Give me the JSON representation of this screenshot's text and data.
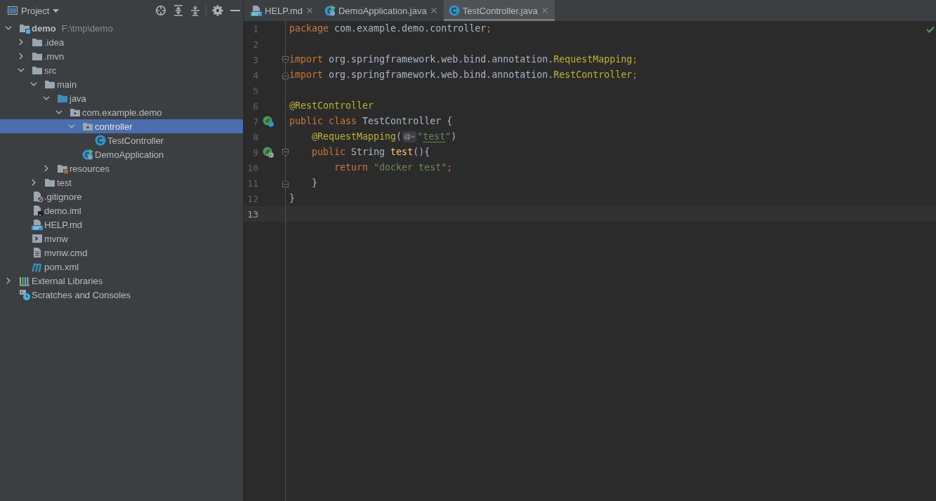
{
  "project": {
    "title": "Project",
    "tree": [
      {
        "label": "demo",
        "path": "F:\\tmp\\demo",
        "kind": "module",
        "expanded": true,
        "selected": false,
        "children": [
          {
            "label": ".idea",
            "kind": "folder",
            "expanded": false,
            "selected": false
          },
          {
            "label": ".mvn",
            "kind": "folder",
            "expanded": false,
            "selected": false
          },
          {
            "label": "src",
            "kind": "folder",
            "expanded": true,
            "selected": false,
            "children": [
              {
                "label": "main",
                "kind": "folder",
                "expanded": true,
                "selected": false,
                "children": [
                  {
                    "label": "java",
                    "kind": "source-folder",
                    "expanded": true,
                    "selected": false,
                    "children": [
                      {
                        "label": "com.example.demo",
                        "kind": "package",
                        "expanded": true,
                        "selected": false,
                        "children": [
                          {
                            "label": "controller",
                            "kind": "package",
                            "expanded": true,
                            "selected": true,
                            "children": [
                              {
                                "label": "TestController",
                                "kind": "class",
                                "selected": false
                              }
                            ]
                          },
                          {
                            "label": "DemoApplication",
                            "kind": "boot-class",
                            "selected": false
                          }
                        ]
                      }
                    ]
                  },
                  {
                    "label": "resources",
                    "kind": "resources-folder",
                    "expanded": false,
                    "selected": false
                  }
                ]
              },
              {
                "label": "test",
                "kind": "folder",
                "expanded": false,
                "selected": false
              }
            ]
          },
          {
            "label": ".gitignore",
            "kind": "ignore-file",
            "selected": false
          },
          {
            "label": "demo.iml",
            "kind": "module-file",
            "selected": false
          },
          {
            "label": "HELP.md",
            "kind": "markdown-file",
            "selected": false
          },
          {
            "label": "mvnw",
            "kind": "script-file",
            "selected": false
          },
          {
            "label": "mvnw.cmd",
            "kind": "text-file",
            "selected": false
          },
          {
            "label": "pom.xml",
            "kind": "maven-file",
            "selected": false
          }
        ]
      },
      {
        "label": "External Libraries",
        "kind": "libraries",
        "expanded": false,
        "selected": false
      },
      {
        "label": "Scratches and Consoles",
        "kind": "scratches",
        "selected": false
      }
    ]
  },
  "editor": {
    "tabs": [
      {
        "label": "HELP.md",
        "kind": "markdown-file",
        "selected": false
      },
      {
        "label": "DemoApplication.java",
        "kind": "boot-class",
        "selected": false
      },
      {
        "label": "TestController.java",
        "kind": "class",
        "selected": true
      }
    ],
    "inspection_ok": true,
    "lines": [
      {
        "number": "1",
        "current": false,
        "words": [
          [
            {
              "text": "package",
              "kind": "keyword"
            }
          ],
          [
            {
              "text": "com.example.demo.controller",
              "kind": "plain"
            },
            {
              "text": ";",
              "kind": "keyword"
            }
          ]
        ]
      },
      {
        "number": "2",
        "current": false
      },
      {
        "number": "3",
        "current": false,
        "fold": {
          "kind": "start"
        },
        "words": [
          [
            {
              "text": "import",
              "kind": "keyword"
            }
          ],
          [
            {
              "text": "org.springframework.web.bind.annotation.",
              "kind": "plain"
            },
            {
              "text": "RequestMapping",
              "kind": "annotation"
            },
            {
              "text": ";",
              "kind": "keyword"
            }
          ]
        ]
      },
      {
        "number": "4",
        "current": false,
        "fold": {
          "kind": "end"
        },
        "words": [
          [
            {
              "text": "import",
              "kind": "keyword"
            }
          ],
          [
            {
              "text": "org.springframework.web.bind.annotation.",
              "kind": "plain"
            },
            {
              "text": "RestController",
              "kind": "annotation"
            },
            {
              "text": ";",
              "kind": "keyword"
            }
          ]
        ]
      },
      {
        "number": "5",
        "current": false
      },
      {
        "number": "6",
        "current": false,
        "words": [
          [
            {
              "text": "@RestController",
              "kind": "annotation"
            }
          ]
        ]
      },
      {
        "number": "7",
        "current": false,
        "gutter_icon": {
          "kind": "class"
        },
        "words": [
          [
            {
              "text": "public",
              "kind": "keyword"
            }
          ],
          [
            {
              "text": "class",
              "kind": "keyword"
            }
          ],
          [
            {
              "text": "TestController",
              "kind": "plain"
            }
          ],
          [
            {
              "text": "{",
              "kind": "plain"
            }
          ]
        ],
        "children": [
          {
            "number": "8",
            "current": false,
            "words": [
              [
                {
                  "text": "@RequestMapping",
                  "kind": "annotation"
                },
                {
                  "text": "(",
                  "kind": "plain"
                },
                {
                  "kind": "inlay"
                },
                {
                  "text": "\"",
                  "kind": "string"
                },
                {
                  "text": "test",
                  "kind": "url"
                },
                {
                  "text": "\"",
                  "kind": "string"
                },
                {
                  "text": ")",
                  "kind": "plain"
                }
              ]
            ]
          },
          {
            "number": "9",
            "current": false,
            "gutter_icon": {
              "kind": "endpoint"
            },
            "fold": {
              "kind": "start"
            },
            "words": [
              [
                {
                  "text": "public",
                  "kind": "keyword"
                }
              ],
              [
                {
                  "text": "String",
                  "kind": "plain"
                }
              ],
              [
                {
                  "text": "test",
                  "kind": "method"
                },
                {
                  "text": "(){",
                  "kind": "plain"
                }
              ]
            ],
            "children": [
              {
                "number": "10",
                "current": false,
                "words": [
                  [
                    {
                      "text": "return",
                      "kind": "keyword"
                    }
                  ],
                  [
                    {
                      "text": "\"docker test\"",
                      "kind": "string"
                    },
                    {
                      "text": ";",
                      "kind": "keyword"
                    }
                  ]
                ]
              }
            ]
          },
          {
            "number": "11",
            "current": false,
            "fold": {
              "kind": "end"
            },
            "words": [
              [
                {
                  "text": "}",
                  "kind": "plain"
                }
              ]
            ]
          }
        ]
      },
      {
        "number": "12",
        "current": false,
        "words": [
          [
            {
              "text": "}",
              "kind": "plain"
            }
          ]
        ]
      },
      {
        "number": "13",
        "current": true
      }
    ]
  }
}
